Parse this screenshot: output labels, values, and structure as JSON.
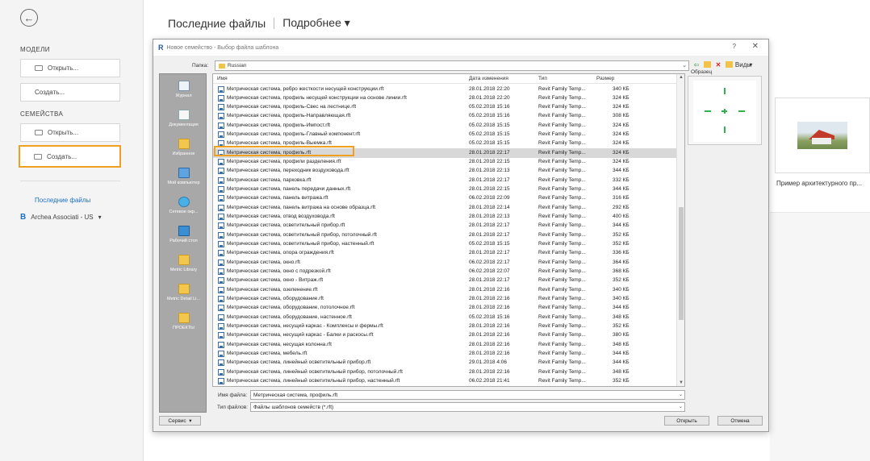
{
  "sidebar": {
    "models_heading": "МОДЕЛИ",
    "models_open": "Открыть...",
    "models_create": "Создать...",
    "families_heading": "СЕМЕЙСТВА",
    "families_open": "Открыть...",
    "families_create": "Создать...",
    "recent_files_link": "Последние файлы",
    "hub_name": "Archea Associati - US",
    "hub_letter": "B"
  },
  "main": {
    "title": "Последние файлы",
    "detail_label": "Подробнее ▾",
    "thumbnail_label": "Пример архитектурного пр..."
  },
  "dialog": {
    "title": "Новое семейство - Выбор файла шаблона",
    "help": "?",
    "close": "✕",
    "folder_label": "Папка:",
    "folder_value": "Russian",
    "views_label": "Виды",
    "preview_label": "Образец",
    "columns": {
      "name": "Имя",
      "date": "Дата изменения",
      "type": "Тип",
      "size": "Размер"
    },
    "places": [
      {
        "label": "Журнал",
        "icon": "journal"
      },
      {
        "label": "Документация",
        "icon": "docs"
      },
      {
        "label": "Избранное",
        "icon": "folder"
      },
      {
        "label": "Мой компьютер",
        "icon": "pc"
      },
      {
        "label": "Сетевое окр...",
        "icon": "net"
      },
      {
        "label": "Рабочий стол",
        "icon": "desk"
      },
      {
        "label": "Metric Library",
        "icon": "folder"
      },
      {
        "label": "Metric Detail Li...",
        "icon": "folder"
      },
      {
        "label": "ПРОЕКТЫ",
        "icon": "folder"
      }
    ],
    "files": [
      {
        "name": "Метрическая система, ребро жесткости несущей конструкции.rft",
        "date": "28.01.2018 22:20",
        "type": "Revit Family Temp...",
        "size": "340 КБ"
      },
      {
        "name": "Метрическая система, профиль несущей конструкции на основе линии.rft",
        "date": "28.01.2018 22:20",
        "type": "Revit Family Temp...",
        "size": "324 КБ"
      },
      {
        "name": "Метрическая система, профиль-Свес на лестнице.rft",
        "date": "05.02.2018 15:16",
        "type": "Revit Family Temp...",
        "size": "324 КБ"
      },
      {
        "name": "Метрическая система, профиль-Направляющая.rft",
        "date": "05.02.2018 15:16",
        "type": "Revit Family Temp...",
        "size": "308 КБ"
      },
      {
        "name": "Метрическая система, профиль-Импост.rft",
        "date": "05.02.2018 15:15",
        "type": "Revit Family Temp...",
        "size": "324 КБ"
      },
      {
        "name": "Метрическая система, профиль-Главный компонент.rft",
        "date": "05.02.2018 15:15",
        "type": "Revit Family Temp...",
        "size": "324 КБ"
      },
      {
        "name": "Метрическая система, профиль-Выемка.rft",
        "date": "05.02.2018 15:15",
        "type": "Revit Family Temp...",
        "size": "324 КБ"
      },
      {
        "name": "Метрическая система, профиль.rft",
        "date": "28.01.2018 22:17",
        "type": "Revit Family Temp...",
        "size": "324 КБ"
      },
      {
        "name": "Метрическая система, профили разделения.rft",
        "date": "28.01.2018 22:15",
        "type": "Revit Family Temp...",
        "size": "324 КБ"
      },
      {
        "name": "Метрическая система, переходник воздуховода.rft",
        "date": "28.01.2018 22:13",
        "type": "Revit Family Temp...",
        "size": "344 КБ"
      },
      {
        "name": "Метрическая система, парковка.rft",
        "date": "28.01.2018 22:17",
        "type": "Revit Family Temp...",
        "size": "332 КБ"
      },
      {
        "name": "Метрическая система, панель передачи данных.rft",
        "date": "28.01.2018 22:15",
        "type": "Revit Family Temp...",
        "size": "344 КБ"
      },
      {
        "name": "Метрическая система, панель витража.rft",
        "date": "06.02.2018 22:09",
        "type": "Revit Family Temp...",
        "size": "316 КБ"
      },
      {
        "name": "Метрическая система, панель витража на основе образца.rft",
        "date": "28.01.2018 22:14",
        "type": "Revit Family Temp...",
        "size": "292 КБ"
      },
      {
        "name": "Метрическая система, отвод воздуховода.rft",
        "date": "28.01.2018 22:13",
        "type": "Revit Family Temp...",
        "size": "400 КБ"
      },
      {
        "name": "Метрическая система, осветительный прибор.rft",
        "date": "28.01.2018 22:17",
        "type": "Revit Family Temp...",
        "size": "344 КБ"
      },
      {
        "name": "Метрическая система, осветительный прибор, потолочный.rft",
        "date": "28.01.2018 22:17",
        "type": "Revit Family Temp...",
        "size": "352 КБ"
      },
      {
        "name": "Метрическая система, осветительный прибор, настенный.rft",
        "date": "05.02.2018 15:15",
        "type": "Revit Family Temp...",
        "size": "352 КБ"
      },
      {
        "name": "Метрическая система, опора ограждения.rft",
        "date": "28.01.2018 22:17",
        "type": "Revit Family Temp...",
        "size": "336 КБ"
      },
      {
        "name": "Метрическая система, окно.rft",
        "date": "06.02.2018 22:17",
        "type": "Revit Family Temp...",
        "size": "364 КБ"
      },
      {
        "name": "Метрическая система, окно с подрезкой.rft",
        "date": "06.02.2018 22:07",
        "type": "Revit Family Temp...",
        "size": "368 КБ"
      },
      {
        "name": "Метрическая система, окно - Витраж.rft",
        "date": "28.01.2018 22:17",
        "type": "Revit Family Temp...",
        "size": "352 КБ"
      },
      {
        "name": "Метрическая система, озеленение.rft",
        "date": "28.01.2018 22:16",
        "type": "Revit Family Temp...",
        "size": "340 КБ"
      },
      {
        "name": "Метрическая система, оборудование.rft",
        "date": "28.01.2018 22:16",
        "type": "Revit Family Temp...",
        "size": "340 КБ"
      },
      {
        "name": "Метрическая система, оборудование, потолочное.rft",
        "date": "28.01.2018 22:16",
        "type": "Revit Family Temp...",
        "size": "344 КБ"
      },
      {
        "name": "Метрическая система, оборудование, настенное.rft",
        "date": "05.02.2018 15:16",
        "type": "Revit Family Temp...",
        "size": "348 КБ"
      },
      {
        "name": "Метрическая система, несущий каркас - Комплексы и фермы.rft",
        "date": "28.01.2018 22:16",
        "type": "Revit Family Temp...",
        "size": "352 КБ"
      },
      {
        "name": "Метрическая система, несущий каркас - Балки и раскосы.rft",
        "date": "28.01.2018 22:16",
        "type": "Revit Family Temp...",
        "size": "380 КБ"
      },
      {
        "name": "Метрическая система, несущая колонна.rft",
        "date": "28.01.2018 22:16",
        "type": "Revit Family Temp...",
        "size": "348 КБ"
      },
      {
        "name": "Метрическая система, мебель.rft",
        "date": "28.01.2018 22:16",
        "type": "Revit Family Temp...",
        "size": "344 КБ"
      },
      {
        "name": "Метрическая система, линейный осветительный прибор.rft",
        "date": "29.01.2018 4:06",
        "type": "Revit Family Temp...",
        "size": "344 КБ"
      },
      {
        "name": "Метрическая система, линейный осветительный прибор, потолочный.rft",
        "date": "28.01.2018 22:16",
        "type": "Revit Family Temp...",
        "size": "348 КБ"
      },
      {
        "name": "Метрическая система, линейный осветительный прибор, настенный.rft",
        "date": "06.02.2018 21:41",
        "type": "Revit Family Temp...",
        "size": "352 КБ"
      }
    ],
    "selected_index": 7,
    "filename_label": "Имя файла:",
    "filename_value": "Метрическая система, профиль.rft",
    "filetype_label": "Тип файлов:",
    "filetype_value": "Файлы шаблонов семейств (*.rft)",
    "service_button": "Сервис",
    "open_button": "Открыть",
    "cancel_button": "Отмена"
  },
  "colors": {
    "highlight": "#f0a020",
    "link": "#1a6fc9"
  }
}
